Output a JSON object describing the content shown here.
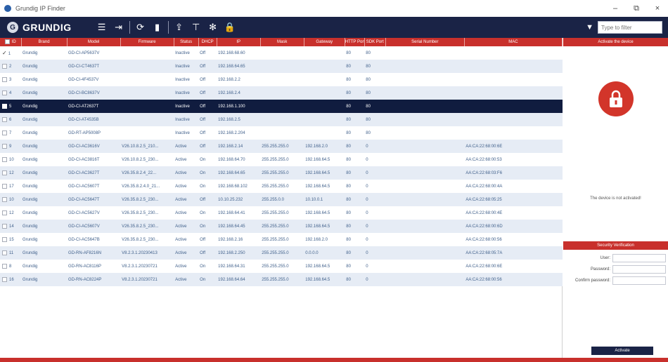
{
  "window": {
    "title": "Grundig IP Finder",
    "controls": [
      "–",
      "⧉",
      "×"
    ]
  },
  "logo": {
    "brand": "GRUNDIG"
  },
  "toolbar": {
    "tools": [
      {
        "name": "list-view-icon",
        "glyph": "☰"
      },
      {
        "name": "export-icon",
        "glyph": "⇥"
      },
      {
        "name": "refresh-icon",
        "glyph": "⟳"
      },
      {
        "name": "save-icon",
        "glyph": "▮"
      },
      {
        "name": "upgrade-icon",
        "glyph": "⇪"
      },
      {
        "name": "network-icon",
        "glyph": "⊤"
      },
      {
        "name": "settings-icon",
        "glyph": "✻"
      },
      {
        "name": "lock-icon",
        "glyph": "🔒"
      }
    ],
    "filter_placeholder": "Type to filter"
  },
  "grid": {
    "columns": [
      "ID",
      "Brand",
      "Model",
      "Firmware",
      "Status",
      "DHCP",
      "IP",
      "Mask",
      "Gateway",
      "HTTP Port",
      "SDK Port",
      "Serial Number",
      "MAC"
    ],
    "rows": [
      [
        "1",
        "Grundig",
        "GD-CI-AP5637V",
        "",
        "Inactive",
        "Off",
        "192.168.68.60",
        "",
        "",
        "80",
        "80",
        "",
        ""
      ],
      [
        "2",
        "Grundig",
        "GD-CI-CT4637T",
        "",
        "Inactive",
        "Off",
        "192.168.64.65",
        "",
        "",
        "80",
        "80",
        "",
        ""
      ],
      [
        "3",
        "Grundig",
        "GD-CI-4F4537V",
        "",
        "Inactive",
        "Off",
        "192.168.2.2",
        "",
        "",
        "80",
        "80",
        "",
        ""
      ],
      [
        "4",
        "Grundig",
        "GD-CI-BC8637V",
        "",
        "Inactive",
        "Off",
        "192.168.2.4",
        "",
        "",
        "80",
        "80",
        "",
        ""
      ],
      [
        "5",
        "Grundig",
        "GD-CI-AT2637T",
        "",
        "Inactive",
        "Off",
        "192.168.1.100",
        "",
        "",
        "80",
        "80",
        "",
        ""
      ],
      [
        "6",
        "Grundig",
        "GD-CI-AT4535B",
        "",
        "Inactive",
        "Off",
        "192.168.2.5",
        "",
        "",
        "80",
        "80",
        "",
        ""
      ],
      [
        "7",
        "Grundig",
        "GD-RT-AP5008P",
        "",
        "Inactive",
        "Off",
        "192.168.2.204",
        "",
        "",
        "80",
        "80",
        "",
        ""
      ],
      [
        "9",
        "Grundig",
        "GD-CI-AC3616V",
        "V26.10.8.2.5_210...",
        "Active",
        "Off",
        "192.168.2.14",
        "255.255.255.0",
        "192.168.2.0",
        "80",
        "0",
        "",
        "AA:CA:22:68:00:6E"
      ],
      [
        "10",
        "Grundig",
        "GD-CI-AC3816T",
        "V26.10.8.2.5_230...",
        "Active",
        "On",
        "192.168.64.70",
        "255.255.255.0",
        "192.168.64.5",
        "80",
        "0",
        "",
        "AA:CA:22:68:00:53"
      ],
      [
        "12",
        "Grundig",
        "GD-CI-AC3627T",
        "V26.35.8.2.4_22...",
        "Active",
        "On",
        "192.168.64.65",
        "255.255.255.0",
        "192.168.64.5",
        "80",
        "0",
        "",
        "AA:CA:22:68:03:F6"
      ],
      [
        "17",
        "Grundig",
        "GD-CI-AC5607T",
        "V26.35.8.2.4.0_21...",
        "Active",
        "On",
        "192.168.68.102",
        "255.255.255.0",
        "192.168.64.5",
        "80",
        "0",
        "",
        "AA:CA:22:68:00:4A"
      ],
      [
        "10",
        "Grundig",
        "GD-CI-AC5647T",
        "V26.35.8.2.5_230...",
        "Active",
        "Off",
        "10.10.25.232",
        "255.255.0.0",
        "10.10.0.1",
        "80",
        "0",
        "",
        "AA:CA:22:68:05:25"
      ],
      [
        "12",
        "Grundig",
        "GD-CI-AC5627V",
        "V26.35.8.2.5_230...",
        "Active",
        "On",
        "192.168.64.41",
        "255.255.255.0",
        "192.168.64.5",
        "80",
        "0",
        "",
        "AA:CA:22:68:00:4E"
      ],
      [
        "14",
        "Grundig",
        "GD-CI-AC5607V",
        "V26.35.8.2.5_230...",
        "Active",
        "On",
        "192.168.64.45",
        "255.255.255.0",
        "192.168.64.5",
        "80",
        "0",
        "",
        "AA:CA:22:68:00:6D"
      ],
      [
        "15",
        "Grundig",
        "GD-CI-AC5647B",
        "V26.35.8.2.5_230...",
        "Active",
        "Off",
        "192.168.2.16",
        "255.255.255.0",
        "192.168.2.0",
        "80",
        "0",
        "",
        "AA:CA:22:68:00:56"
      ],
      [
        "11",
        "Grundig",
        "GD-RN-AF8216N",
        "V8.2.3.1.20230413",
        "Active",
        "Off",
        "192.168.2.250",
        "255.255.255.0",
        "0.0.0.0",
        "80",
        "0",
        "",
        "AA:CA:22:68:05:7A"
      ],
      [
        "8",
        "Grundig",
        "GD-RN-AC8116P",
        "V8.2.3.1.20230721",
        "Active",
        "On",
        "192.168.64.31",
        "255.255.255.0",
        "192.168.64.5",
        "80",
        "0",
        "",
        "AA:CA:22:68:00:6E"
      ],
      [
        "16",
        "Grundig",
        "GD-RN-AC8224P",
        "V8.2.3.1.20230721",
        "Active",
        "On",
        "192.168.64.64",
        "255.255.255.0",
        "192.168.64.5",
        "80",
        "0",
        "",
        "AA:CA:22:68:00:56"
      ]
    ],
    "checked_row": 0,
    "selected_row": 4
  },
  "side": {
    "header": "Activate the device",
    "message": "The device is not activated!",
    "security_header": "Security Verification",
    "user_label": "User:",
    "password_label": "Password:",
    "confirm_label": "Confirm password:",
    "activate_label": "Activate"
  }
}
